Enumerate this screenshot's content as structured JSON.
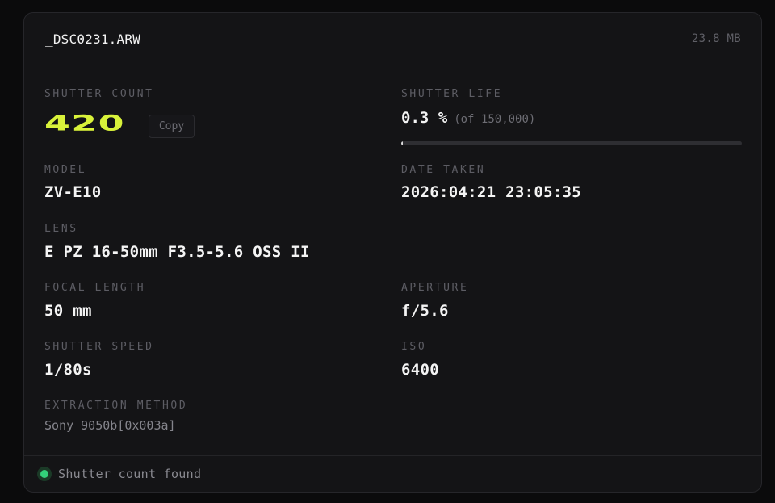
{
  "file": {
    "name": "_DSC0231.ARW",
    "size": "23.8 MB"
  },
  "shutter_count": {
    "label": "SHUTTER COUNT",
    "value": "420",
    "copy_label": "Copy"
  },
  "shutter_life": {
    "label": "SHUTTER LIFE",
    "percent_text": "0.3 %",
    "of_text": "(of 150,000)",
    "fraction": 0.003
  },
  "fields": {
    "model": {
      "label": "MODEL",
      "value": "ZV-E10"
    },
    "date_taken": {
      "label": "DATE TAKEN",
      "value": "2026:04:21 23:05:35"
    },
    "lens": {
      "label": "LENS",
      "value": "E PZ 16-50mm F3.5-5.6 OSS II"
    },
    "focal_length": {
      "label": "FOCAL LENGTH",
      "value": "50 mm"
    },
    "aperture": {
      "label": "APERTURE",
      "value": "f/5.6"
    },
    "shutter_speed": {
      "label": "SHUTTER SPEED",
      "value": "1/80s"
    },
    "iso": {
      "label": "ISO",
      "value": "6400"
    },
    "extraction_method": {
      "label": "EXTRACTION METHOD",
      "value": "Sony 9050b[0x003a]"
    }
  },
  "status": {
    "text": "Shutter count found",
    "color": "#33d17a"
  },
  "colors": {
    "accent": "#d9f23a"
  }
}
